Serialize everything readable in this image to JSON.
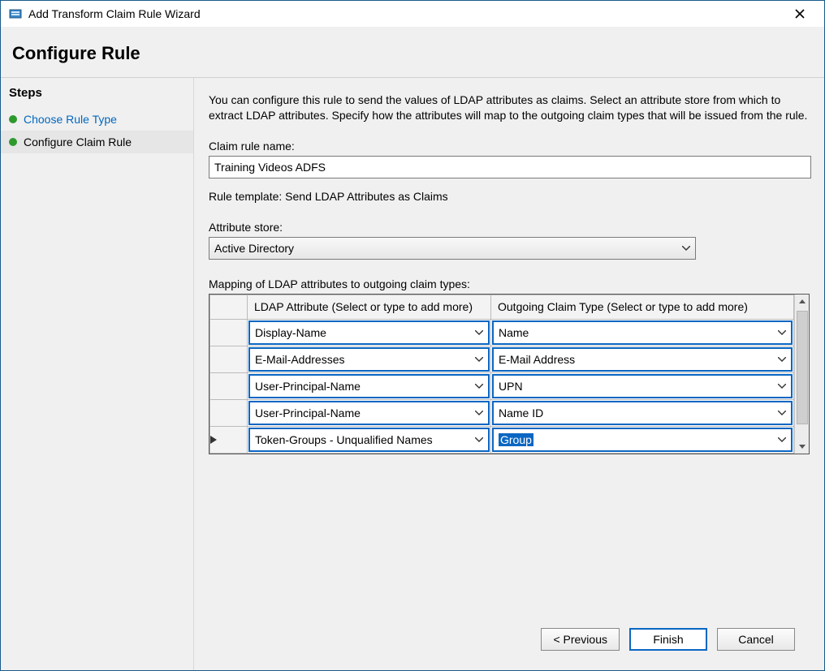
{
  "window": {
    "title": "Add Transform Claim Rule Wizard"
  },
  "heading": "Configure Rule",
  "sidebar": {
    "title": "Steps",
    "items": [
      {
        "label": "Choose Rule Type",
        "link": true,
        "current": false
      },
      {
        "label": "Configure Claim Rule",
        "link": false,
        "current": true
      }
    ]
  },
  "main": {
    "intro": "You can configure this rule to send the values of LDAP attributes as claims. Select an attribute store from which to extract LDAP attributes. Specify how the attributes will map to the outgoing claim types that will be issued from the rule.",
    "claim_rule_name_label": "Claim rule name:",
    "claim_rule_name_value": "Training Videos ADFS",
    "rule_template_text": "Rule template: Send LDAP Attributes as Claims",
    "attribute_store_label": "Attribute store:",
    "attribute_store_value": "Active Directory",
    "mapping_label": "Mapping of LDAP attributes to outgoing claim types:",
    "grid": {
      "headers": {
        "ldap": "LDAP Attribute (Select or type to add more)",
        "claim": "Outgoing Claim Type (Select or type to add more)"
      },
      "rows": [
        {
          "ldap": "Display-Name",
          "claim": "Name",
          "active": false
        },
        {
          "ldap": "E-Mail-Addresses",
          "claim": "E-Mail Address",
          "active": false
        },
        {
          "ldap": "User-Principal-Name",
          "claim": "UPN",
          "active": false
        },
        {
          "ldap": "User-Principal-Name",
          "claim": "Name ID",
          "active": false
        },
        {
          "ldap": "Token-Groups - Unqualified Names",
          "claim": "Group",
          "active": true,
          "claim_selected": true
        }
      ]
    }
  },
  "buttons": {
    "previous": "< Previous",
    "finish": "Finish",
    "cancel": "Cancel"
  }
}
